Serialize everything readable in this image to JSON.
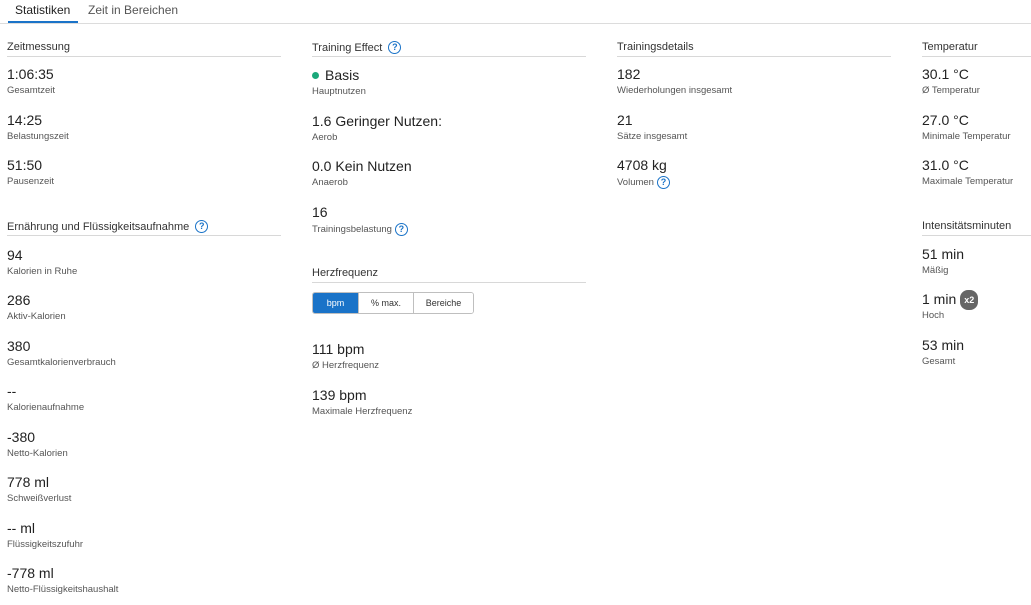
{
  "tabs": [
    "Statistiken",
    "Zeit in Bereichen"
  ],
  "colors": {
    "accent": "#1a73c8",
    "status_dot": "#1aa87a"
  },
  "zeitmessung": {
    "title": "Zeitmessung",
    "items": [
      {
        "value": "1:06:35",
        "label": "Gesamtzeit"
      },
      {
        "value": "14:25",
        "label": "Belastungszeit"
      },
      {
        "value": "51:50",
        "label": "Pausenzeit"
      }
    ]
  },
  "ernaehrung": {
    "title": "Ernährung und Flüssigkeitsaufnahme",
    "items": [
      {
        "value": "94",
        "label": "Kalorien in Ruhe"
      },
      {
        "value": "286",
        "label": "Aktiv-Kalorien"
      },
      {
        "value": "380",
        "label": "Gesamtkalorienverbrauch"
      },
      {
        "value": "--",
        "label": "Kalorienaufnahme"
      },
      {
        "value": "-380",
        "label": "Netto-Kalorien"
      },
      {
        "value": "778 ml",
        "label": "Schweißverlust"
      },
      {
        "value": "-- ml",
        "label": "Flüssigkeitszufuhr"
      },
      {
        "value": "-778 ml",
        "label": "Netto-Flüssigkeitshaushalt"
      }
    ]
  },
  "training_effect": {
    "title": "Training Effect",
    "items": [
      {
        "value": "Basis",
        "label": "Hauptnutzen"
      },
      {
        "value": "1.6 Geringer Nutzen:",
        "label": "Aerob"
      },
      {
        "value": "0.0 Kein Nutzen",
        "label": "Anaerob"
      },
      {
        "value": "16",
        "label": "Trainingsbelastung"
      }
    ]
  },
  "herzfrequenz": {
    "title": "Herzfrequenz",
    "segments": [
      "bpm",
      "% max.",
      "Bereiche"
    ],
    "items": [
      {
        "value": "111 bpm",
        "label": "Ø Herzfrequenz"
      },
      {
        "value": "139 bpm",
        "label": "Maximale Herzfrequenz"
      }
    ]
  },
  "trainingsdetails": {
    "title": "Trainingsdetails",
    "items": [
      {
        "value": "182",
        "label": "Wiederholungen insgesamt"
      },
      {
        "value": "21",
        "label": "Sätze insgesamt"
      },
      {
        "value": "4708 kg",
        "label": "Volumen"
      }
    ]
  },
  "temperatur": {
    "title": "Temperatur",
    "items": [
      {
        "value": "30.1 °C",
        "label": "Ø Temperatur"
      },
      {
        "value": "27.0 °C",
        "label": "Minimale Temperatur"
      },
      {
        "value": "31.0 °C",
        "label": "Maximale Temperatur"
      }
    ]
  },
  "intensitaet": {
    "title": "Intensitätsminuten",
    "badge": "x2",
    "items": [
      {
        "value": "51 min",
        "label": "Mäßig"
      },
      {
        "value": "1 min",
        "label": "Hoch"
      },
      {
        "value": "53 min",
        "label": "Gesamt"
      }
    ]
  }
}
